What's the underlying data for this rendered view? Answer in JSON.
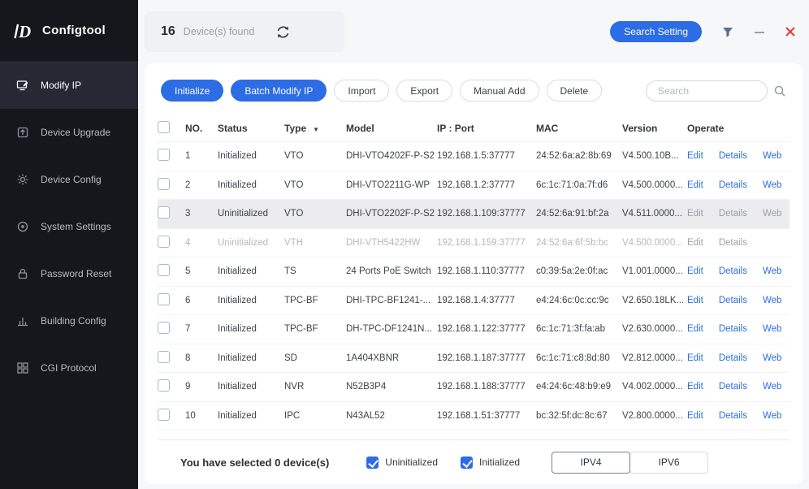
{
  "app": {
    "name": "Configtool"
  },
  "titlebar": {
    "device_count": "16",
    "device_count_label": "Device(s) found",
    "search_setting": "Search Setting"
  },
  "icons": {
    "logo": "configtool-logo",
    "refresh": "refresh-icon",
    "filter": "filter-icon",
    "minimize": "minimize-icon",
    "close": "close-icon",
    "search": "search-icon",
    "type_filter": "chevron-down-icon"
  },
  "sidebar": {
    "items": [
      {
        "label": "Modify IP",
        "active": true
      },
      {
        "label": "Device Upgrade"
      },
      {
        "label": "Device Config"
      },
      {
        "label": "System Settings"
      },
      {
        "label": "Password Reset"
      },
      {
        "label": "Building Config"
      },
      {
        "label": "CGI Protocol"
      }
    ]
  },
  "toolbar": {
    "initialize": "Initialize",
    "batch_modify_ip": "Batch Modify IP",
    "import": "Import",
    "export": "Export",
    "manual_add": "Manual Add",
    "delete": "Delete",
    "search_placeholder": "Search"
  },
  "table": {
    "headers": {
      "no": "NO.",
      "status": "Status",
      "type": "Type",
      "model": "Model",
      "ip_port": "IP : Port",
      "mac": "MAC",
      "version": "Version",
      "operate": "Operate"
    },
    "rows": [
      {
        "no": "1",
        "status": "Initialized",
        "type": "VTO",
        "model": "DHI-VTO4202F-P-S2",
        "ip_port": "192.168.1.5:37777",
        "mac": "24:52:6a:a2:8b:69",
        "version": "V4.500.10B...",
        "ops": [
          "Edit",
          "Details",
          "Web"
        ]
      },
      {
        "no": "2",
        "status": "Initialized",
        "type": "VTO",
        "model": "DHI-VTO2211G-WP",
        "ip_port": "192.168.1.2:37777",
        "mac": "6c:1c:71:0a:7f:d6",
        "version": "V4.500.0000...",
        "ops": [
          "Edit",
          "Details",
          "Web"
        ]
      },
      {
        "no": "3",
        "status": "Uninitialized",
        "type": "VTO",
        "model": "DHI-VTO2202F-P-S2",
        "ip_port": "192.168.1.109:37777",
        "mac": "24:52:6a:91:bf:2a",
        "version": "V4.511.0000...",
        "ops": [
          "Edit",
          "Details",
          "Web"
        ],
        "state": "highlighted",
        "ops_muted": true
      },
      {
        "no": "4",
        "status": "Uninitialized",
        "type": "VTH",
        "model": "DHI-VTH5422HW",
        "ip_port": "192.168.1.159:37777",
        "mac": "24:52:6a:6f:5b:bc",
        "version": "V4.500.0000...",
        "ops": [
          "Edit",
          "Details"
        ],
        "state": "muted",
        "ops_muted": true
      },
      {
        "no": "5",
        "status": "Initialized",
        "type": "TS",
        "model": "24 Ports PoE Switch",
        "ip_port": "192.168.1.110:37777",
        "mac": "c0:39:5a:2e:0f:ac",
        "version": "V1.001.0000...",
        "ops": [
          "Edit",
          "Details",
          "Web"
        ]
      },
      {
        "no": "6",
        "status": "Initialized",
        "type": "TPC-BF",
        "model": "DHI-TPC-BF1241-...",
        "ip_port": "192.168.1.4:37777",
        "mac": "e4:24:6c:0c:cc:9c",
        "version": "V2.650.18LK...",
        "ops": [
          "Edit",
          "Details",
          "Web"
        ]
      },
      {
        "no": "7",
        "status": "Initialized",
        "type": "TPC-BF",
        "model": "DH-TPC-DF1241N...",
        "ip_port": "192.168.1.122:37777",
        "mac": "6c:1c:71:3f:fa:ab",
        "version": "V2.630.0000...",
        "ops": [
          "Edit",
          "Details",
          "Web"
        ]
      },
      {
        "no": "8",
        "status": "Initialized",
        "type": "SD",
        "model": "1A404XBNR",
        "ip_port": "192.168.1.187:37777",
        "mac": "6c:1c:71:c8:8d:80",
        "version": "V2.812.0000...",
        "ops": [
          "Edit",
          "Details",
          "Web"
        ]
      },
      {
        "no": "9",
        "status": "Initialized",
        "type": "NVR",
        "model": "N52B3P4",
        "ip_port": "192.168.1.188:37777",
        "mac": "e4:24:6c:48:b9:e9",
        "version": "V4.002.0000...",
        "ops": [
          "Edit",
          "Details",
          "Web"
        ]
      },
      {
        "no": "10",
        "status": "Initialized",
        "type": "IPC",
        "model": "N43AL52",
        "ip_port": "192.168.1.51:37777",
        "mac": "bc:32:5f:dc:8c:67",
        "version": "V2.800.0000...",
        "ops": [
          "Edit",
          "Details",
          "Web"
        ]
      }
    ]
  },
  "footer": {
    "selected_text": "You have selected 0  device(s)",
    "uninitialized_label": "Uninitialized",
    "initialized_label": "Initialized",
    "ipv4": "IPV4",
    "ipv6": "IPV6"
  },
  "colors": {
    "accent": "#2c6ce4",
    "danger": "#e23a3a"
  }
}
